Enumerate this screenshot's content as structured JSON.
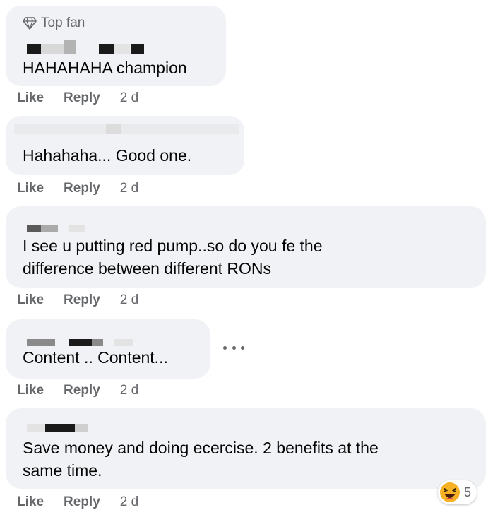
{
  "badge_label": "Top fan",
  "comments": [
    {
      "text_lines": [
        "HAHAHAHA champion"
      ],
      "like": "Like",
      "reply": "Reply",
      "time": "2 d"
    },
    {
      "text_lines": [
        "Hahahaha... Good one."
      ],
      "like": "Like",
      "reply": "Reply",
      "time": "2 d"
    },
    {
      "text_lines": [
        "I see u putting red pump..so do you fe the",
        "difference between different RONs"
      ],
      "like": "Like",
      "reply": "Reply",
      "time": "2 d"
    },
    {
      "text_lines": [
        "Content .. Content..."
      ],
      "like": "Like",
      "reply": "Reply",
      "time": "2 d"
    },
    {
      "text_lines": [
        "Save money and doing ecercise. 2 benefits at the",
        "same time."
      ],
      "like": "Like",
      "reply": "Reply",
      "time": "2 d"
    }
  ],
  "reaction": {
    "icon": "haha-emoji-icon",
    "count": "5"
  },
  "colors": {
    "bubble": "#f0f2f5",
    "secondary_text": "#65676b",
    "primary_text": "#050505",
    "emoji_yellow": "#f7b125"
  }
}
